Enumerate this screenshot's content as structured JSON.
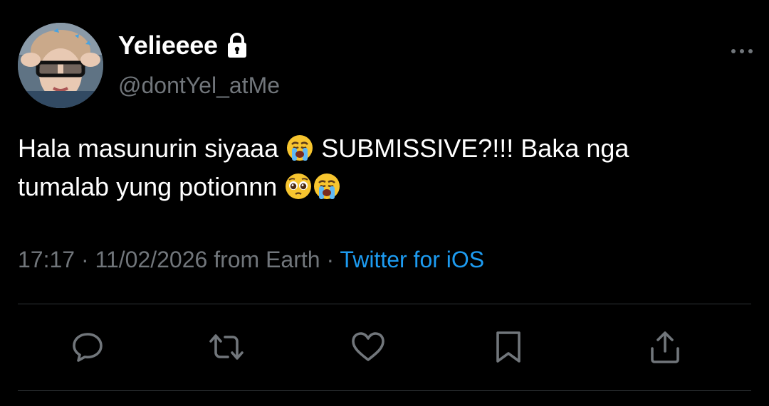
{
  "user": {
    "display_name": "Yelieeee",
    "handle": "@dontYel_atMe",
    "protected_icon": "lock-icon"
  },
  "tweet": {
    "text_line1_a": "Hala masunurin siyaaa ",
    "text_line1_b": " SUBMISSIVE?!!! Baka nga",
    "text_line2_a": "tumalab yung potionnn ",
    "emojis": [
      "loudly-crying-face",
      "pleading-face",
      "loudly-crying-face"
    ]
  },
  "meta": {
    "time": "17:17",
    "separator1": " · ",
    "date": "11/02/2026",
    "location": " from Earth",
    "separator2": " · ",
    "source": "Twitter for iOS"
  },
  "actions": {
    "icons": [
      "reply-icon",
      "retweet-icon",
      "like-icon",
      "bookmark-icon",
      "share-icon"
    ]
  },
  "colors": {
    "background": "#000000",
    "text": "#ffffff",
    "secondary": "#71767b",
    "accent": "#1d9bf0",
    "divider": "#2f3336"
  }
}
